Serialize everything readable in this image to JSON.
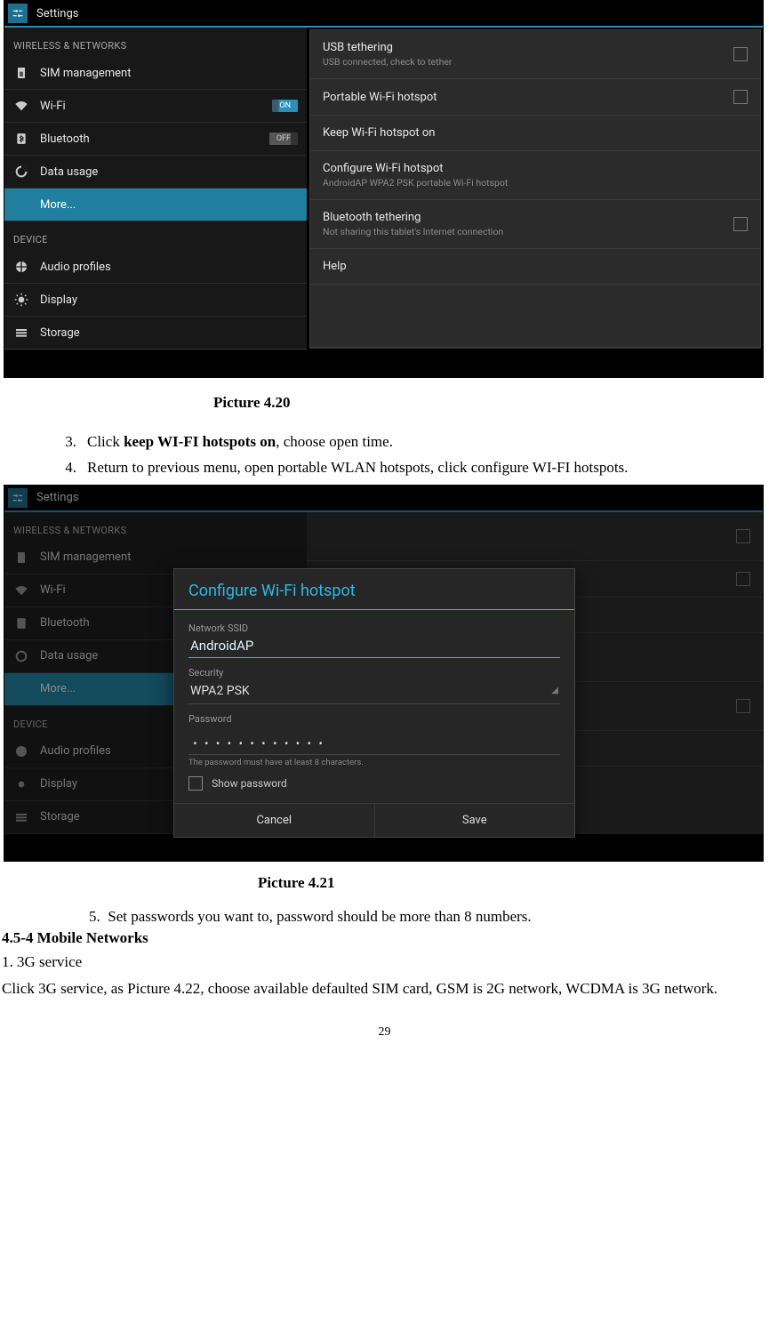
{
  "androidTitle": "Settings",
  "section1": "WIRELESS & NETWORKS",
  "section2": "DEVICE",
  "sidebar": {
    "sim": "SIM management",
    "wifi": "Wi-Fi",
    "wifiBadge": "ON",
    "bt": "Bluetooth",
    "btBadge": "OFF",
    "data": "Data usage",
    "more": "More...",
    "audio": "Audio profiles",
    "display": "Display",
    "storage": "Storage"
  },
  "panel": {
    "usbTitle": "USB tethering",
    "usbSub": "USB connected, check to tether",
    "portable": "Portable Wi-Fi hotspot",
    "keep": "Keep Wi-Fi hotspot on",
    "configTitle": "Configure Wi-Fi hotspot",
    "configSub": "AndroidAP WPA2 PSK portable Wi-Fi hotspot",
    "btTetherTitle": "Bluetooth tethering",
    "btTetherSub": "Not sharing this tablet's Internet connection",
    "help": "Help"
  },
  "caption1": "Picture 4.20",
  "step3num": "3.",
  "step3": "Click keep WI-FI hotspots on, choose open time.",
  "step3a": "Click ",
  "step3bold": "keep WI-FI hotspots on",
  "step3b": ", choose open time.",
  "step4num": "4.",
  "step4": "Return to previous menu, open portable WLAN hotspots, click configure WI-FI hotspots.",
  "dialog": {
    "title": "Configure Wi-Fi hotspot",
    "ssidLabel": "Network SSID",
    "ssid": "AndroidAP",
    "secLabel": "Security",
    "sec": "WPA2 PSK",
    "pwLabel": "Password",
    "pw": "............",
    "hint": "The password must have at least 8 characters.",
    "showpw": "Show password",
    "cancel": "Cancel",
    "save": "Save"
  },
  "caption2": "Picture 4.21",
  "step5num": "5.",
  "step5": "Set passwords you want to, password should be more than 8 numbers.",
  "secHead": "4.5-4 Mobile Networks",
  "line1": "1. 3G service",
  "line2": "Click 3G service, as Picture 4.22, choose available defaulted SIM card, GSM is 2G network, WCDMA is 3G network.",
  "pageNum": "29"
}
